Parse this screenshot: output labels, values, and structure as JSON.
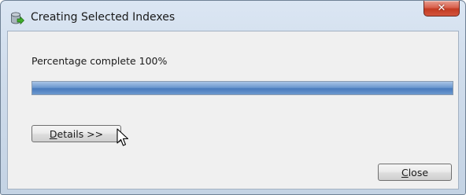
{
  "window": {
    "title": "Creating Selected Indexes",
    "close_glyph": "✕"
  },
  "status": {
    "text": "Percentage complete 100%",
    "progress_percent": 100
  },
  "buttons": {
    "details_label": "Details >>",
    "close_label": "Close"
  },
  "icons": {
    "app": "database-index-icon",
    "window_close": "close-icon",
    "pointer": "mouse-cursor-icon"
  },
  "colors": {
    "progress_fill": "#5b89c6",
    "close_button": "#c9452c"
  }
}
